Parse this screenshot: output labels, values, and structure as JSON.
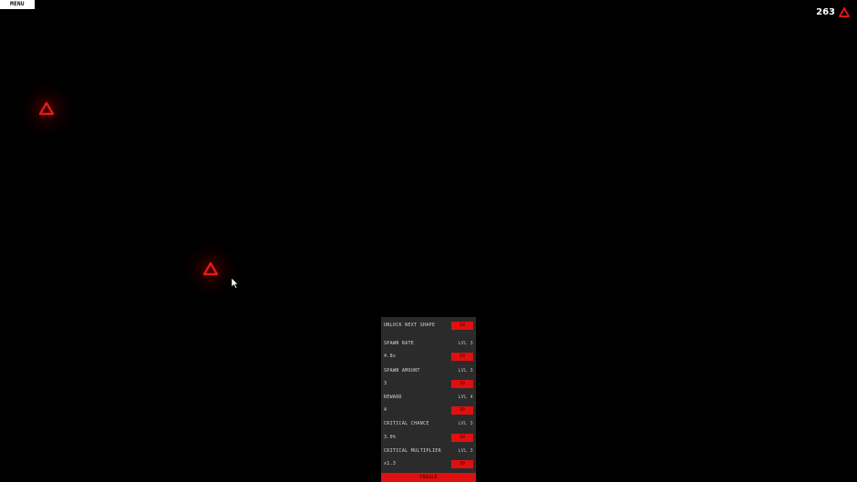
{
  "menu": {
    "label": "MENU"
  },
  "score": {
    "value": "263",
    "icon": "triangle-icon"
  },
  "colors": {
    "accent": "#e01010",
    "panel": "#2b2b2b",
    "background": "#000000"
  },
  "upgrades": {
    "unlock": {
      "label": "UNLOCK NEXT SHAPE",
      "button": "30"
    },
    "spawn_rate": {
      "label": "SPAWN RATE",
      "level": "LVL 3",
      "value": "4.8s",
      "button": "30"
    },
    "spawn_amount": {
      "label": "SPAWN AMOUNT",
      "level": "LVL 3",
      "value": "3",
      "button": "30"
    },
    "reward": {
      "label": "REWARD",
      "level": "LVL 4",
      "value": "4",
      "button": "30"
    },
    "critical_chance": {
      "label": "CRITICAL CHANCE",
      "level": "LVL 3",
      "value": "3.0%",
      "button": "30"
    },
    "critical_multiplier": {
      "label": "CRITICAL MULTIPLIER",
      "level": "LVL 3",
      "value": "x1.3",
      "button": "30"
    },
    "toggle": "TOGGLE"
  }
}
